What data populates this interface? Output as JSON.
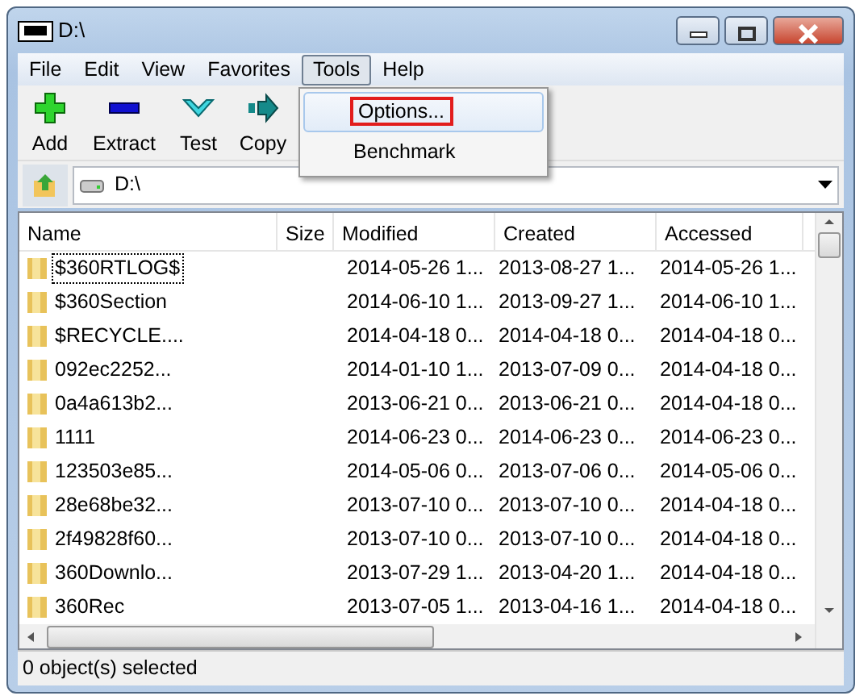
{
  "window": {
    "title": "D:\\"
  },
  "menu": [
    {
      "label": "File",
      "open": false
    },
    {
      "label": "Edit",
      "open": false
    },
    {
      "label": "View",
      "open": false
    },
    {
      "label": "Favorites",
      "open": false
    },
    {
      "label": "Tools",
      "open": true
    },
    {
      "label": "Help",
      "open": false
    }
  ],
  "dropdown": [
    {
      "label": "Options...",
      "selected": true
    },
    {
      "label": "Benchmark",
      "selected": false
    }
  ],
  "toolbar": [
    {
      "kind": "add",
      "label": "Add"
    },
    {
      "kind": "extract",
      "label": "Extract"
    },
    {
      "kind": "test",
      "label": "Test"
    },
    {
      "kind": "copy",
      "label": "Copy"
    }
  ],
  "address": {
    "value": "D:\\"
  },
  "table": {
    "columns": [
      "Name",
      "Size",
      "Modified",
      "Created",
      "Accessed"
    ],
    "rows": [
      {
        "name": "$360RTLOG$",
        "focused": true,
        "modified": "2014-05-26 1...",
        "created": "2013-08-27 1...",
        "accessed": "2014-05-26 1..."
      },
      {
        "name": "$360Section",
        "focused": false,
        "modified": "2014-06-10 1...",
        "created": "2013-09-27 1...",
        "accessed": "2014-06-10 1..."
      },
      {
        "name": "$RECYCLE....",
        "focused": false,
        "modified": "2014-04-18 0...",
        "created": "2014-04-18 0...",
        "accessed": "2014-04-18 0..."
      },
      {
        "name": "092ec2252...",
        "focused": false,
        "modified": "2014-01-10 1...",
        "created": "2013-07-09 0...",
        "accessed": "2014-04-18 0..."
      },
      {
        "name": "0a4a613b2...",
        "focused": false,
        "modified": "2013-06-21 0...",
        "created": "2013-06-21 0...",
        "accessed": "2014-04-18 0..."
      },
      {
        "name": "1111",
        "focused": false,
        "modified": "2014-06-23 0...",
        "created": "2014-06-23 0...",
        "accessed": "2014-06-23 0..."
      },
      {
        "name": "123503e85...",
        "focused": false,
        "modified": "2014-05-06 0...",
        "created": "2013-07-06 0...",
        "accessed": "2014-05-06 0..."
      },
      {
        "name": "28e68be32...",
        "focused": false,
        "modified": "2013-07-10 0...",
        "created": "2013-07-10 0...",
        "accessed": "2014-04-18 0..."
      },
      {
        "name": "2f49828f60...",
        "focused": false,
        "modified": "2013-07-10 0...",
        "created": "2013-07-10 0...",
        "accessed": "2014-04-18 0..."
      },
      {
        "name": "360Downlo...",
        "focused": false,
        "modified": "2013-07-29 1...",
        "created": "2013-04-20 1...",
        "accessed": "2014-04-18 0..."
      },
      {
        "name": "360Rec",
        "focused": false,
        "modified": "2013-07-05 1...",
        "created": "2013-04-16 1...",
        "accessed": "2014-04-18 0..."
      }
    ]
  },
  "status_bar": "0 object(s) selected"
}
